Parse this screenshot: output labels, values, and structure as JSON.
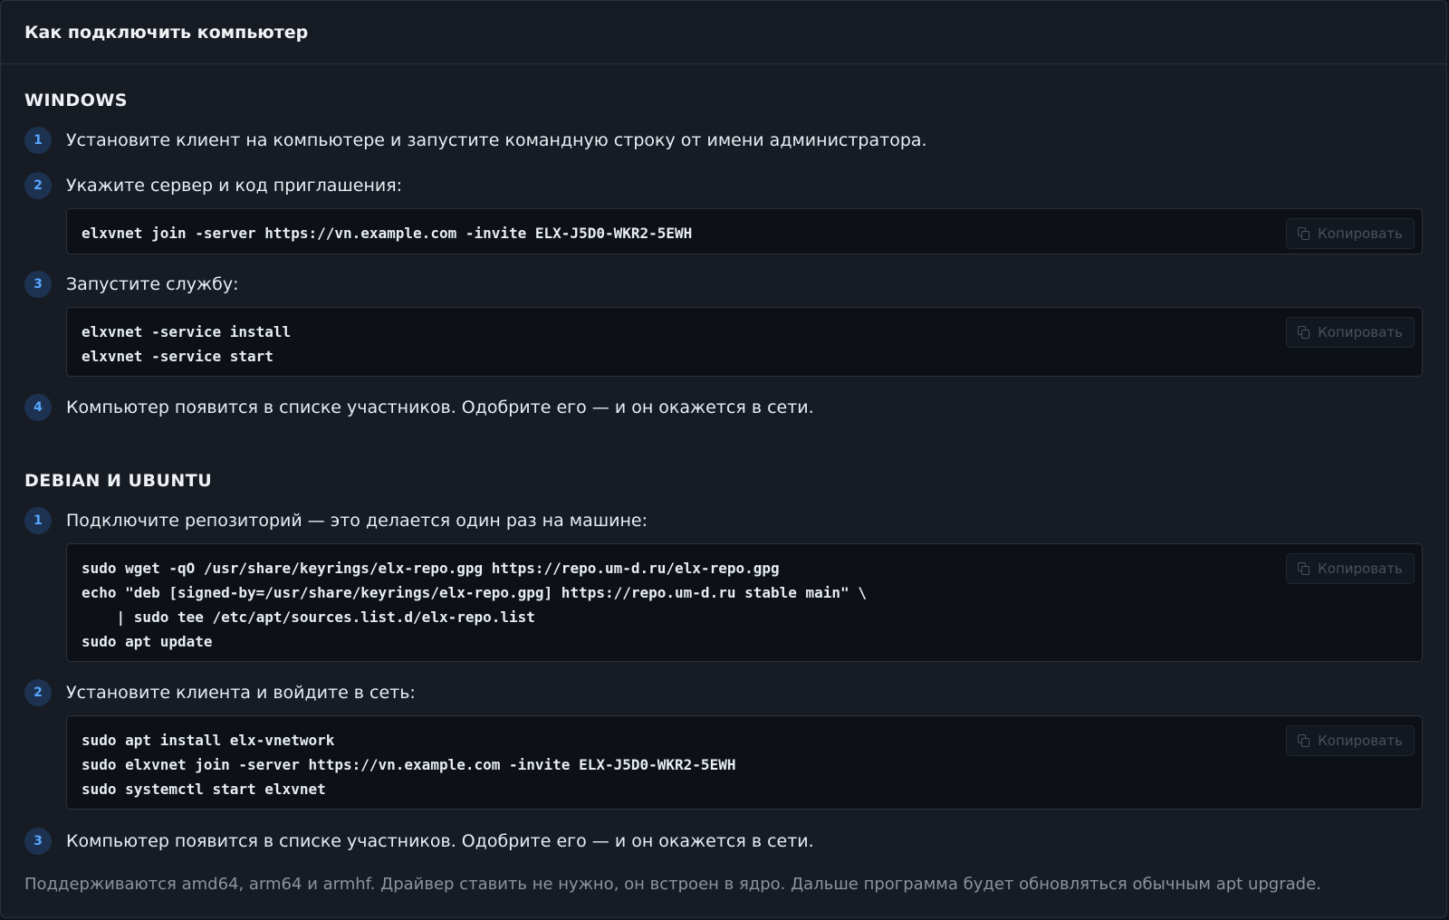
{
  "panel": {
    "title": "Как подключить компьютер"
  },
  "copy_label": "Копировать",
  "windows": {
    "title": "WINDOWS",
    "steps": [
      {
        "num": "1",
        "text": "Установите клиент на компьютере и запустите командную строку от имени администратора."
      },
      {
        "num": "2",
        "text": "Укажите сервер и код приглашения:",
        "code": [
          "elxvnet join -server https://vn.example.com -invite ELX-J5D0-WKR2-5EWH"
        ]
      },
      {
        "num": "3",
        "text": "Запустите службу:",
        "code": [
          "elxvnet -service install",
          "elxvnet -service start"
        ]
      },
      {
        "num": "4",
        "text": "Компьютер появится в списке участников. Одобрите его — и он окажется в сети."
      }
    ]
  },
  "debian": {
    "title": "DEBIAN И UBUNTU",
    "steps": [
      {
        "num": "1",
        "text": "Подключите репозиторий — это делается один раз на машине:",
        "code": [
          "sudo wget -qO /usr/share/keyrings/elx-repo.gpg https://repo.um-d.ru/elx-repo.gpg",
          "echo \"deb [signed-by=/usr/share/keyrings/elx-repo.gpg] https://repo.um-d.ru stable main\" \\",
          "    | sudo tee /etc/apt/sources.list.d/elx-repo.list",
          "sudo apt update"
        ]
      },
      {
        "num": "2",
        "text": "Установите клиента и войдите в сеть:",
        "code": [
          "sudo apt install elx-vnetwork",
          "sudo elxvnet join -server https://vn.example.com -invite ELX-J5D0-WKR2-5EWH",
          "sudo systemctl start elxvnet"
        ]
      },
      {
        "num": "3",
        "text": "Компьютер появится в списке участников. Одобрите его — и он окажется в сети."
      }
    ]
  },
  "footer_note": "Поддерживаются amd64, arm64 и armhf. Драйвер ставить не нужно, он встроен в ядро. Дальше программа будет обновляться обычным apt upgrade.",
  "colors": {
    "background": "#171c24",
    "badge_bg": "#1c3250",
    "badge_fg": "#58a6ff",
    "code_bg": "#0d1117"
  }
}
